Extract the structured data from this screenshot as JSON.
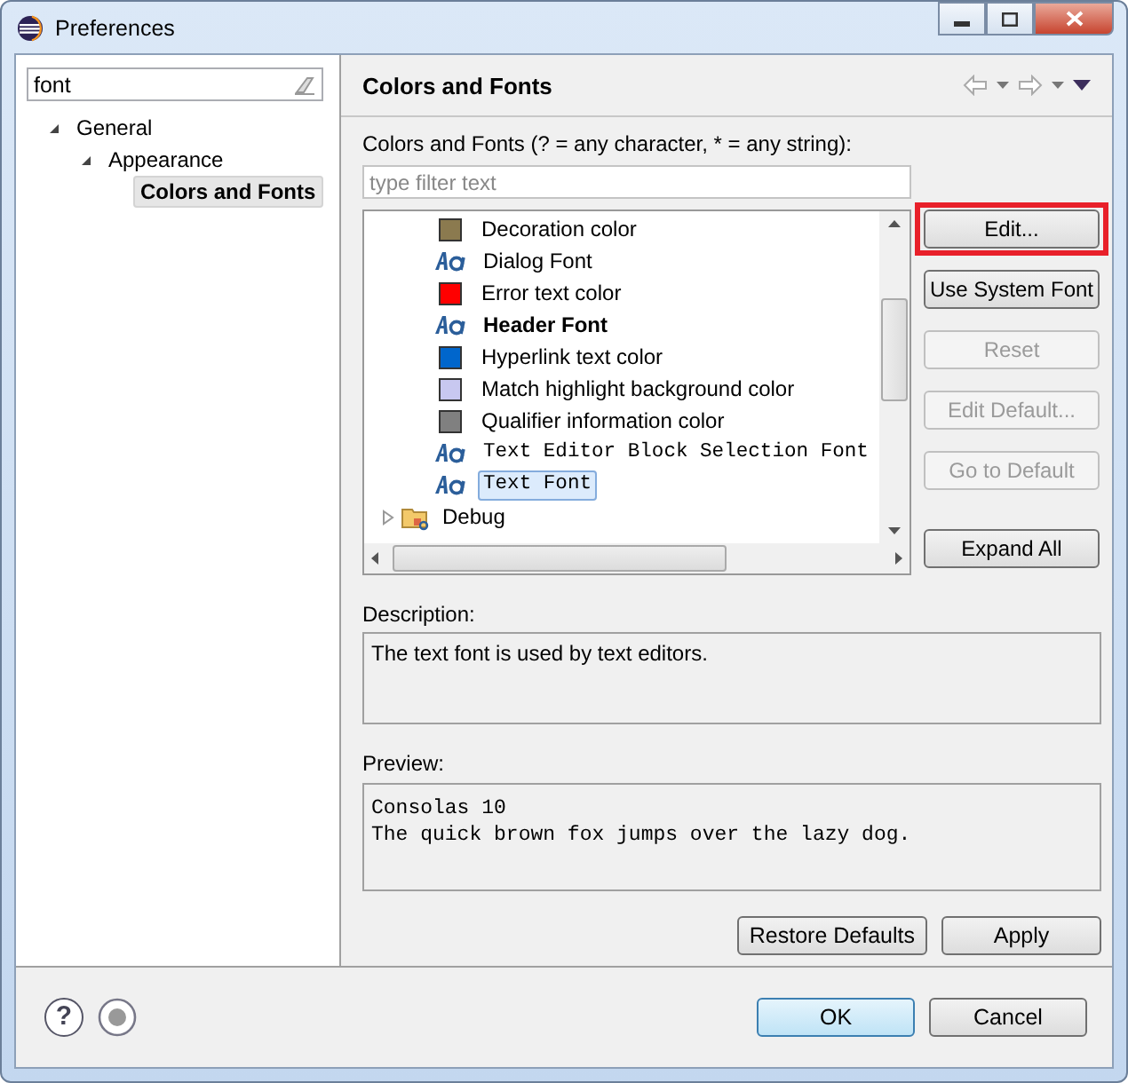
{
  "window": {
    "title": "Preferences"
  },
  "sidebar": {
    "filter": {
      "value": "font"
    },
    "tree": [
      {
        "label": "General",
        "expanded": true,
        "selected": false,
        "children": [
          {
            "label": "Appearance",
            "expanded": true,
            "selected": false,
            "children": [
              {
                "label": "Colors and Fonts",
                "selected": true
              }
            ]
          }
        ]
      }
    ]
  },
  "page": {
    "title": "Colors and Fonts",
    "filter_label": "Colors and Fonts (? = any character, * = any string):",
    "filter": {
      "placeholder": "type filter text"
    },
    "items": [
      {
        "kind": "color",
        "label": "Decoration color",
        "color": "#8b7a4f",
        "selected": false
      },
      {
        "kind": "font",
        "label": "Dialog Font",
        "selected": false
      },
      {
        "kind": "color",
        "label": "Error text color",
        "color": "#ff0000",
        "selected": false
      },
      {
        "kind": "boldfont",
        "label": "Header Font",
        "selected": false
      },
      {
        "kind": "color",
        "label": "Hyperlink text color",
        "color": "#0066cc",
        "selected": false
      },
      {
        "kind": "color",
        "label": "Match highlight background color",
        "color": "#c8c8f0",
        "selected": false
      },
      {
        "kind": "color",
        "label": "Qualifier information color",
        "color": "#808080",
        "selected": false
      },
      {
        "kind": "monofont",
        "label": "Text Editor Block Selection Font",
        "selected": false
      },
      {
        "kind": "monofont",
        "label": "Text Font",
        "selected": true
      },
      {
        "kind": "folder",
        "label": "Debug",
        "expanded": false,
        "selected": false
      }
    ],
    "buttons": [
      {
        "label": "Edit...",
        "disabled": false,
        "highlighted": true
      },
      {
        "label": "Use System Font",
        "disabled": false,
        "highlighted": false
      },
      {
        "label": "Reset",
        "disabled": true,
        "highlighted": false
      },
      {
        "label": "Edit Default...",
        "disabled": true,
        "highlighted": false
      },
      {
        "label": "Go to Default",
        "disabled": true,
        "highlighted": false
      },
      {
        "label": "Expand All",
        "disabled": false,
        "highlighted": false
      }
    ],
    "description_label": "Description:",
    "description": "The text font is used by text editors.",
    "preview_label": "Preview:",
    "preview_lines": [
      "Consolas 10",
      "The quick brown fox jumps over the lazy dog."
    ],
    "actions": [
      {
        "label": "Restore Defaults"
      },
      {
        "label": "Apply"
      }
    ]
  },
  "footer": {
    "help": "?",
    "buttons": [
      {
        "label": "OK",
        "default": true
      },
      {
        "label": "Cancel",
        "default": false
      }
    ]
  }
}
